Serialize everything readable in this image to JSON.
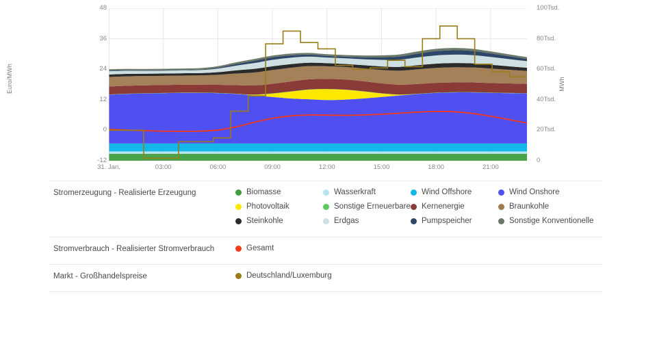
{
  "chart_data": {
    "type": "area",
    "title": "",
    "subtitle": "",
    "xlabel": "",
    "ylabel_left": "Euro/MWh",
    "ylabel_right": "MWh",
    "grid": true,
    "legend_position": "bottom",
    "x": [
      "00:00",
      "01:00",
      "02:00",
      "03:00",
      "04:00",
      "05:00",
      "06:00",
      "07:00",
      "08:00",
      "09:00",
      "10:00",
      "11:00",
      "12:00",
      "13:00",
      "14:00",
      "15:00",
      "16:00",
      "17:00",
      "18:00",
      "19:00",
      "20:00",
      "21:00",
      "22:00",
      "23:00"
    ],
    "xticks": [
      "31. Jan.",
      "03:00",
      "06:00",
      "09:00",
      "12:00",
      "15:00",
      "18:00",
      "21:00"
    ],
    "xtick_positions": [
      0,
      3,
      6,
      9,
      12,
      15,
      18,
      21
    ],
    "yticks_left": [
      "-12",
      "0",
      "12",
      "24",
      "36",
      "48"
    ],
    "ylim_left": [
      -12,
      48
    ],
    "yticks_right": [
      "0",
      "20Tsd.",
      "40Tsd.",
      "60Tsd.",
      "80Tsd.",
      "100Tsd."
    ],
    "ylim_right": [
      0,
      100000
    ],
    "series": [
      {
        "name": "Biomasse",
        "color": "#4aa34a",
        "values": [
          4600,
          4600,
          4600,
          4600,
          4600,
          4600,
          4600,
          4600,
          4600,
          4600,
          4600,
          4600,
          4600,
          4600,
          4600,
          4600,
          4600,
          4600,
          4600,
          4600,
          4600,
          4600,
          4600,
          4600
        ]
      },
      {
        "name": "Wasserkraft",
        "color": "#b6e3f0",
        "values": [
          1500,
          1500,
          1500,
          1500,
          1500,
          1500,
          1500,
          1500,
          1500,
          1500,
          1500,
          1500,
          1500,
          1500,
          1500,
          1500,
          1500,
          1500,
          1500,
          1500,
          1500,
          1500,
          1500,
          1500
        ]
      },
      {
        "name": "Wind Offshore",
        "color": "#14b8e8",
        "values": [
          5200,
          5200,
          5200,
          5200,
          5200,
          5200,
          5200,
          5200,
          5200,
          5200,
          5200,
          5200,
          5200,
          5200,
          5200,
          5200,
          5200,
          5200,
          5200,
          5200,
          5200,
          5200,
          5200,
          5200
        ]
      },
      {
        "name": "Wind Onshore",
        "color": "#5050f0",
        "values": [
          32000,
          32500,
          32800,
          33000,
          33200,
          33200,
          33000,
          32500,
          31500,
          30500,
          29500,
          29000,
          28500,
          28800,
          29500,
          30500,
          31500,
          32500,
          33200,
          33500,
          33500,
          33200,
          33000,
          32800
        ]
      },
      {
        "name": "Photovoltaik",
        "color": "#ffe800",
        "values": [
          0,
          0,
          0,
          0,
          0,
          0,
          0,
          0,
          400,
          2200,
          4500,
          6300,
          7100,
          6400,
          4600,
          2300,
          500,
          0,
          0,
          0,
          0,
          0,
          0,
          0
        ]
      },
      {
        "name": "Sonstige Erneuerbare",
        "color": "#5cc95c",
        "values": [
          150,
          150,
          150,
          150,
          150,
          150,
          150,
          150,
          150,
          150,
          150,
          150,
          150,
          150,
          150,
          150,
          150,
          150,
          150,
          150,
          150,
          150,
          150,
          150
        ]
      },
      {
        "name": "Kernenergie",
        "color": "#8a3b38",
        "values": [
          5200,
          5200,
          5200,
          5200,
          5200,
          5200,
          5300,
          5600,
          6000,
          6300,
          6500,
          6600,
          6600,
          6600,
          6600,
          6500,
          6400,
          6400,
          6400,
          6400,
          6400,
          6300,
          6200,
          6100
        ]
      },
      {
        "name": "Braunkohle",
        "color": "#a5815a",
        "values": [
          6300,
          6200,
          6100,
          6000,
          6000,
          6100,
          6600,
          7600,
          8500,
          9000,
          9000,
          8700,
          8300,
          8200,
          8400,
          8800,
          9200,
          9600,
          9800,
          9900,
          9800,
          9500,
          9000,
          8500
        ]
      },
      {
        "name": "Steinkohle",
        "color": "#2b2b2b",
        "values": [
          1600,
          1600,
          1500,
          1500,
          1500,
          1500,
          1700,
          2100,
          2400,
          2500,
          2400,
          2200,
          2000,
          2000,
          2100,
          2300,
          2500,
          2700,
          2800,
          2800,
          2700,
          2500,
          2300,
          2100
        ]
      },
      {
        "name": "Erdgas",
        "color": "#cfe0e2",
        "values": [
          2100,
          2000,
          1900,
          1900,
          1900,
          2000,
          2400,
          3100,
          3800,
          4200,
          4200,
          4000,
          3700,
          3700,
          3900,
          4300,
          4700,
          5100,
          5400,
          5500,
          5400,
          5100,
          4700,
          4300
        ]
      },
      {
        "name": "Pumpspeicher",
        "color": "#2e4668",
        "values": [
          400,
          350,
          300,
          300,
          300,
          350,
          600,
          1100,
          1500,
          1600,
          1500,
          1300,
          1100,
          1100,
          1300,
          1700,
          2100,
          2500,
          2800,
          2900,
          2700,
          2300,
          1900,
          1500
        ]
      },
      {
        "name": "Sonstige Konventionelle",
        "color": "#6b7a68",
        "values": [
          900,
          900,
          900,
          900,
          900,
          900,
          950,
          1050,
          1150,
          1200,
          1200,
          1150,
          1100,
          1100,
          1150,
          1250,
          1350,
          1450,
          1500,
          1500,
          1450,
          1350,
          1250,
          1150
        ]
      }
    ],
    "consumption": {
      "name": "Gesamt",
      "color": "#f5391a",
      "values": [
        20600,
        20100,
        19700,
        19400,
        19300,
        19400,
        20100,
        22200,
        25200,
        27800,
        29400,
        30000,
        29900,
        29800,
        30000,
        30500,
        31200,
        31900,
        32300,
        32100,
        31000,
        29200,
        27000,
        24700
      ]
    },
    "price": {
      "name": "Deutschland/Luxemburg",
      "color": "#9a7d18",
      "unit": "Euro/MWh",
      "values": [
        0.0,
        0.0,
        -11.0,
        -11.0,
        -4.5,
        -4.5,
        -3.0,
        7.5,
        13.5,
        34.0,
        39.0,
        34.5,
        32.0,
        25.5,
        24.0,
        24.5,
        27.5,
        25.0,
        36.0,
        41.0,
        36.0,
        26.0,
        23.0,
        21.0
      ]
    }
  },
  "legend": {
    "rows": [
      {
        "category": "Stromerzeugung - Realisierte Erzeugung",
        "items": [
          {
            "label": "Biomasse",
            "color": "#3f9c3f"
          },
          {
            "label": "Wasserkraft",
            "color": "#b6e3f0"
          },
          {
            "label": "Wind Offshore",
            "color": "#14b8e8"
          },
          {
            "label": "Wind Onshore",
            "color": "#5050f0"
          },
          {
            "label": "Photovoltaik",
            "color": "#ffe800"
          },
          {
            "label": "Sonstige Erneuerbare",
            "color": "#5cc95c"
          },
          {
            "label": "Kernenergie",
            "color": "#8a3b38"
          },
          {
            "label": "Braunkohle",
            "color": "#9e7a4f"
          },
          {
            "label": "Steinkohle",
            "color": "#2b2b2b"
          },
          {
            "label": "Erdgas",
            "color": "#cfe0e2"
          },
          {
            "label": "Pumpspeicher",
            "color": "#2e4668"
          },
          {
            "label": "Sonstige Konventionelle",
            "color": "#6b7a68"
          }
        ]
      },
      {
        "category": "Stromverbrauch - Realisierter Stromverbrauch",
        "items": [
          {
            "label": "Gesamt",
            "color": "#f5391a"
          }
        ]
      },
      {
        "category": "Markt - Großhandelspreise",
        "items": [
          {
            "label": "Deutschland/Luxemburg",
            "color": "#9a7d18"
          }
        ]
      }
    ]
  }
}
